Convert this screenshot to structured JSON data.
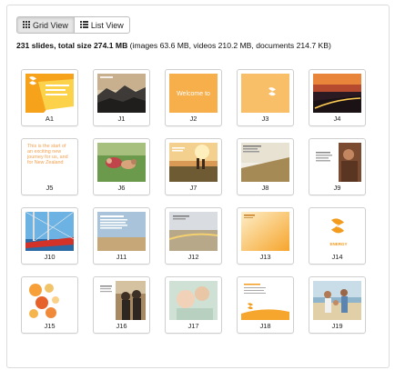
{
  "toolbar": {
    "grid_view_label": "Grid View",
    "list_view_label": "List View",
    "grid_icon": "grid-icon",
    "list_icon": "list-icon"
  },
  "summary": {
    "count_text": "231 slides, total size 274.1 MB",
    "detail_text": " (images 63.6 MB, videos 210.2 MB, documents 214.7 KB)"
  },
  "slides": [
    {
      "label": "A1",
      "kind": "cover"
    },
    {
      "label": "J1",
      "kind": "mountains"
    },
    {
      "label": "J2",
      "kind": "welcome",
      "text": "Welcome to"
    },
    {
      "label": "J3",
      "kind": "logo-orange"
    },
    {
      "label": "J4",
      "kind": "road"
    },
    {
      "label": "J5",
      "kind": "text",
      "text": "This is the start of an exciting new journey for us, and for New Zealand"
    },
    {
      "label": "J6",
      "kind": "people"
    },
    {
      "label": "J7",
      "kind": "walkers"
    },
    {
      "label": "J8",
      "kind": "grass"
    },
    {
      "label": "J9",
      "kind": "portrait"
    },
    {
      "label": "J10",
      "kind": "sail"
    },
    {
      "label": "J11",
      "kind": "bluetext"
    },
    {
      "label": "J12",
      "kind": "beach"
    },
    {
      "label": "J13",
      "kind": "orange-grad"
    },
    {
      "label": "J14",
      "kind": "logo-white",
      "text": "ENERGY"
    },
    {
      "label": "J15",
      "kind": "circles"
    },
    {
      "label": "J16",
      "kind": "couple"
    },
    {
      "label": "J17",
      "kind": "child"
    },
    {
      "label": "J18",
      "kind": "doc"
    },
    {
      "label": "J19",
      "kind": "family"
    }
  ]
}
